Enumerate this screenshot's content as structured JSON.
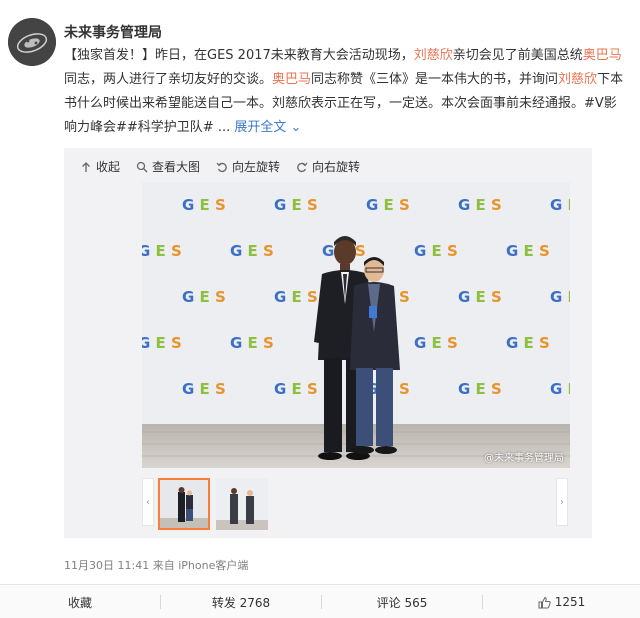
{
  "post": {
    "author": "未来事务管理局",
    "text_lines": [
      [
        "【独家首发！】昨日，在GES 2017未来教育大会活动现场，",
        "刘慈欣",
        "亲切会见了前美国总统",
        "奥巴马"
      ],
      [
        "同志，两人进行了亲切友好的交谈。",
        "奥巴马",
        "同志称赞《三体》是一本伟大的书，并询问",
        "刘慈欣",
        "下本"
      ],
      [
        "书什么时候出来希望能送自己一本。刘慈欣表示正在写，一定送。本次会面事前未经通报。#V影"
      ],
      [
        "响力峰会##科学护卫队#",
        " ... 展开全文",
        "⌄"
      ]
    ],
    "line1": {
      "a": "【独家首发！】昨日，在GES 2017未来教育大会活动现场，",
      "b": "刘慈欣",
      "c": "亲切会见了前美国总统",
      "d": "奥巴马"
    },
    "line2": {
      "a": "同志，两人进行了亲切友好的交谈。",
      "b": "奥巴马",
      "c": "同志称赞《三体》是一本伟大的书，并询问",
      "d": "刘慈欣",
      "e": "下本"
    },
    "line3": "书什么时候出来希望能送自己一本。刘慈欣表示正在写，一定送。本次会面事前未经通报。#V影",
    "line4": {
      "tags": "响力峰会##科学护卫队#",
      "ellipsis": "...",
      "expand": "展开全文"
    }
  },
  "media": {
    "toolbar": {
      "collapse": "收起",
      "view_large": "查看大图",
      "rotate_left": "向左旋转",
      "rotate_right": "向右旋转"
    },
    "backdrop_logo": "GES",
    "watermark": "@未来事务管理局"
  },
  "meta": {
    "time": "11月30日 11:41",
    "from": "来自",
    "client": "iPhone客户端"
  },
  "actions": {
    "favorite": "收藏",
    "repost": "转发 2768",
    "comment": "评论 565",
    "like": "1251"
  },
  "colors": {
    "highlight": "#eb7350",
    "link": "#3a7cc8",
    "thumb_active_border": "#fa7d3c"
  }
}
